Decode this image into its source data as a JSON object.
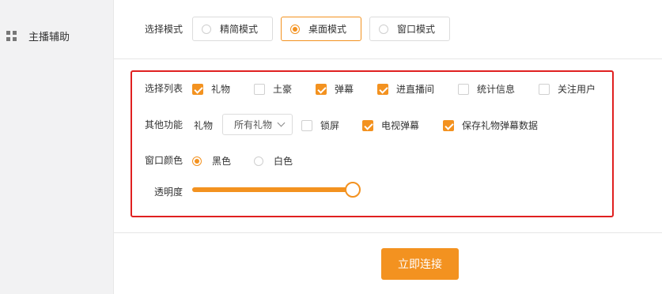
{
  "sidebar": {
    "items": [
      {
        "label": "主播辅助",
        "icon": "grid-icon"
      }
    ]
  },
  "mode": {
    "label": "选择模式",
    "options": [
      {
        "label": "精简模式",
        "selected": false
      },
      {
        "label": "桌面模式",
        "selected": true
      },
      {
        "label": "窗口模式",
        "selected": false
      }
    ]
  },
  "list": {
    "label": "选择列表",
    "items": [
      {
        "label": "礼物",
        "checked": true
      },
      {
        "label": "土豪",
        "checked": false
      },
      {
        "label": "弹幕",
        "checked": true
      },
      {
        "label": "进直播间",
        "checked": true
      },
      {
        "label": "统计信息",
        "checked": false
      },
      {
        "label": "关注用户",
        "checked": false
      }
    ]
  },
  "other": {
    "label": "其他功能",
    "gift_label": "礼物",
    "gift_select": "所有礼物",
    "items": [
      {
        "label": "锁屏",
        "checked": false
      },
      {
        "label": "电视弹幕",
        "checked": true
      },
      {
        "label": "保存礼物弹幕数据",
        "checked": true
      }
    ]
  },
  "window_color": {
    "label": "窗口颜色",
    "options": [
      {
        "label": "黑色",
        "selected": true
      },
      {
        "label": "白色",
        "selected": false
      }
    ]
  },
  "opacity": {
    "label": "透明度",
    "value": 1.0
  },
  "connect_button": "立即连接",
  "colors": {
    "accent": "#f39220",
    "highlight_border": "#e02020",
    "sidebar_bg": "#f2f2f3"
  }
}
